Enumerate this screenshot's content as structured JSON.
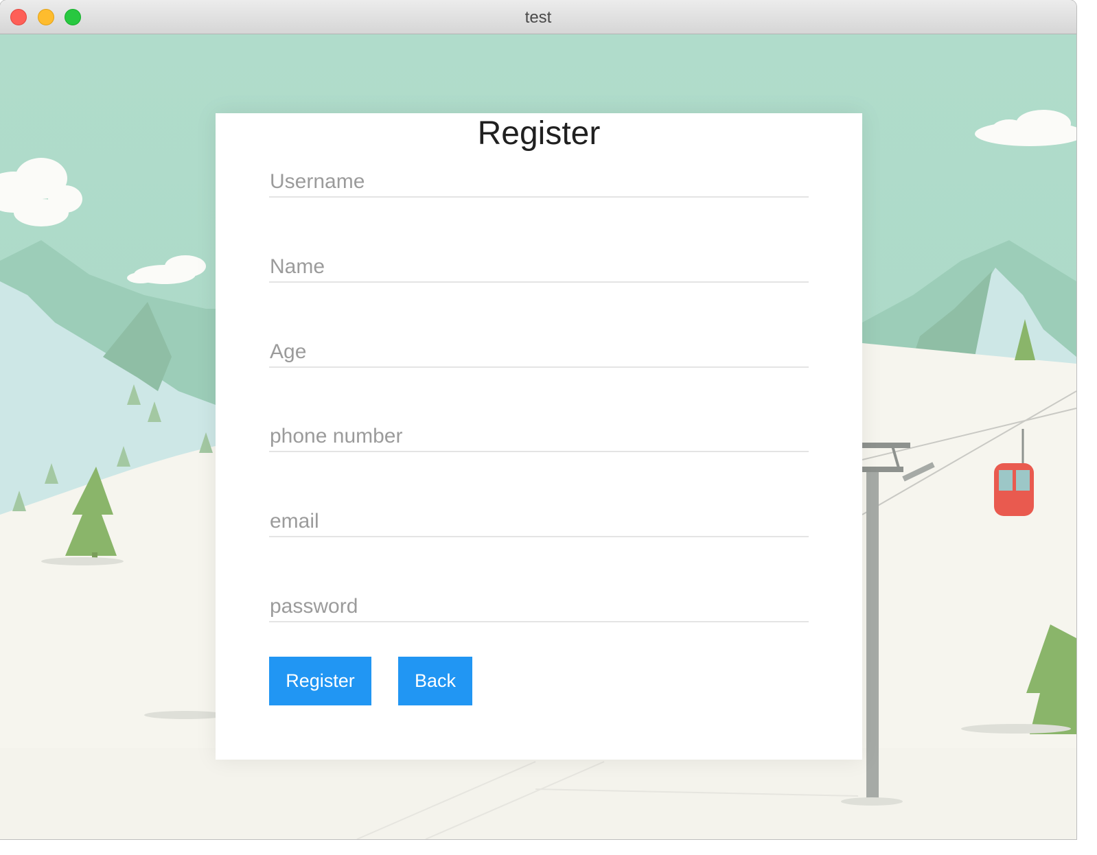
{
  "window": {
    "title": "test"
  },
  "form": {
    "title": "Register",
    "fields": [
      {
        "placeholder": "Username",
        "value": ""
      },
      {
        "placeholder": "Name",
        "value": ""
      },
      {
        "placeholder": "Age",
        "value": ""
      },
      {
        "placeholder": "phone number",
        "value": ""
      },
      {
        "placeholder": "email",
        "value": ""
      },
      {
        "placeholder": "password",
        "value": ""
      }
    ],
    "buttons": {
      "register": "Register",
      "back": "Back"
    }
  },
  "colors": {
    "accent": "#2196f3",
    "sky": "#b3ddcd",
    "snow": "#f6f5ee",
    "close": "#fe5f57",
    "minimize": "#febc2e",
    "maximize": "#28c840"
  }
}
